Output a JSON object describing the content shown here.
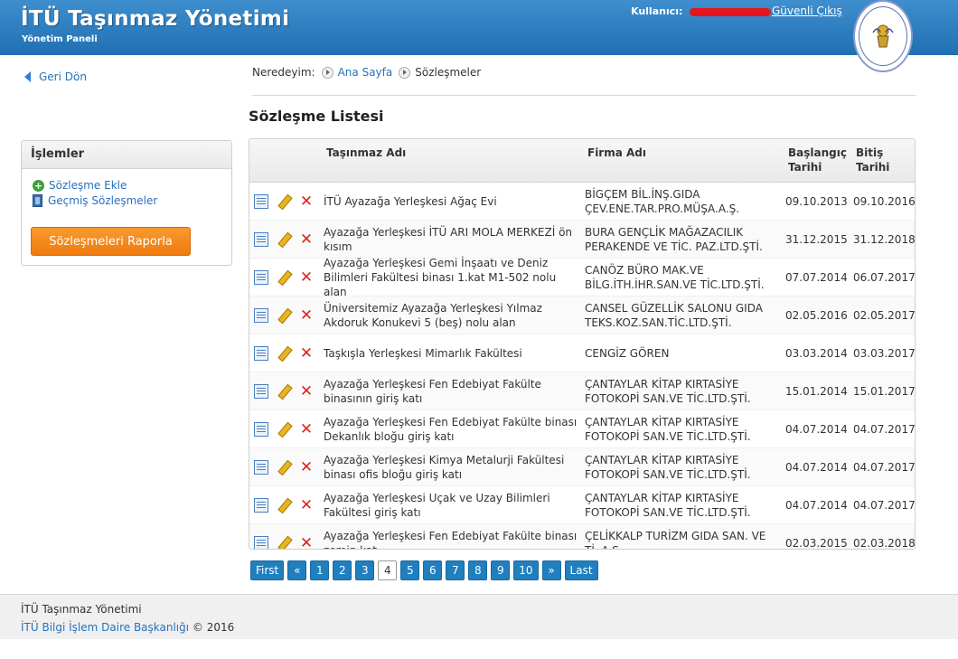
{
  "header": {
    "title": "İTÜ Taşınmaz Yönetimi",
    "subtitle": "Yönetim Paneli",
    "user_label": "Kullanıcı:",
    "logout": "Güvenli Çıkış"
  },
  "back": {
    "label": "Geri Dön"
  },
  "breadcrumb": {
    "label": "Neredeyim:",
    "home": "Ana Sayfa",
    "current": "Sözleşmeler"
  },
  "page_title": "Sözleşme Listesi",
  "sidebar": {
    "title": "İşlemler",
    "add": "Sözleşme Ekle",
    "history": "Geçmiş Sözleşmeler",
    "report_button": "Sözleşmeleri Raporla"
  },
  "table": {
    "columns": {
      "name": "Taşınmaz Adı",
      "company": "Firma Adı",
      "start_1": "Başlangıç",
      "start_2": "Tarihi",
      "end_1": "Bitiş",
      "end_2": "Tarihi"
    },
    "rows": [
      {
        "name": "İTÜ Ayazağa Yerleşkesi Ağaç Evi",
        "company": "BİGÇEM BİL.İNŞ.GIDA ÇEV.ENE.TAR.PRO.MÜŞA.A.Ş.",
        "start": "09.10.2013",
        "end": "09.10.2016"
      },
      {
        "name": "Ayazağa Yerleşkesi İTÜ ARI MOLA MERKEZİ ön kısım",
        "company": "BURA GENÇLİK MAĞAZACILIK PERAKENDE VE TİC. PAZ.LTD.ŞTİ.",
        "start": "31.12.2015",
        "end": "31.12.2018"
      },
      {
        "name": "Ayazağa Yerleşkesi Gemi İnşaatı ve Deniz Bilimleri Fakültesi binası 1.kat M1-502 nolu alan",
        "company": "CANÖZ BÜRO MAK.VE BİLG.İTH.İHR.SAN.VE TİC.LTD.ŞTİ.",
        "start": "07.07.2014",
        "end": "06.07.2017"
      },
      {
        "name": "Üniversitemiz Ayazağa Yerleşkesi Yılmaz Akdoruk Konukevi 5 (beş) nolu alan",
        "company": "CANSEL GÜZELLİK SALONU GIDA TEKS.KOZ.SAN.TİC.LTD.ŞTİ.",
        "start": "02.05.2016",
        "end": "02.05.2017"
      },
      {
        "name": "Taşkışla Yerleşkesi Mimarlık Fakültesi",
        "company": "CENGİZ GÖREN",
        "start": "03.03.2014",
        "end": "03.03.2017"
      },
      {
        "name": "Ayazağa Yerleşkesi Fen Edebiyat Fakülte binasının giriş katı",
        "company": "ÇANTAYLAR KİTAP KIRTASİYE FOTOKOPİ SAN.VE TİC.LTD.ŞTİ.",
        "start": "15.01.2014",
        "end": "15.01.2017"
      },
      {
        "name": "Ayazağa Yerleşkesi Fen Edebiyat Fakülte binası Dekanlık bloğu giriş katı",
        "company": "ÇANTAYLAR KİTAP KIRTASİYE FOTOKOPİ SAN.VE TİC.LTD.ŞTİ.",
        "start": "04.07.2014",
        "end": "04.07.2017"
      },
      {
        "name": "Ayazağa Yerleşkesi Kimya Metalurji Fakültesi binası ofis bloğu giriş katı",
        "company": "ÇANTAYLAR KİTAP KIRTASİYE FOTOKOPİ SAN.VE TİC.LTD.ŞTİ.",
        "start": "04.07.2014",
        "end": "04.07.2017"
      },
      {
        "name": "Ayazağa Yerleşkesi Uçak ve Uzay Bilimleri Fakültesi giriş katı",
        "company": "ÇANTAYLAR KİTAP KIRTASİYE FOTOKOPİ SAN.VE TİC.LTD.ŞTİ.",
        "start": "04.07.2014",
        "end": "04.07.2017"
      },
      {
        "name": "Ayazağa Yerleşkesi Fen Edebiyat Fakülte binası zemin kat",
        "company": "ÇELİKKALP TURİZM GIDA SAN. VE Tİ. A.Ş.",
        "start": "02.03.2015",
        "end": "02.03.2018"
      }
    ]
  },
  "pagination": {
    "first": "First",
    "prev": "«",
    "pages": [
      "1",
      "2",
      "3",
      "4",
      "5",
      "6",
      "7",
      "8",
      "9",
      "10"
    ],
    "current": "4",
    "next": "»",
    "last": "Last"
  },
  "footer": {
    "line1": "İTÜ Taşınmaz Yönetimi",
    "org": "İTÜ Bilgi İşlem Daire Başkanlığı",
    "copyright": "© 2016"
  },
  "colors": {
    "header": "#2b7cc0",
    "accent_link": "#2672bb",
    "report_button": "#f28a1c",
    "pager": "#1f7fbf"
  }
}
